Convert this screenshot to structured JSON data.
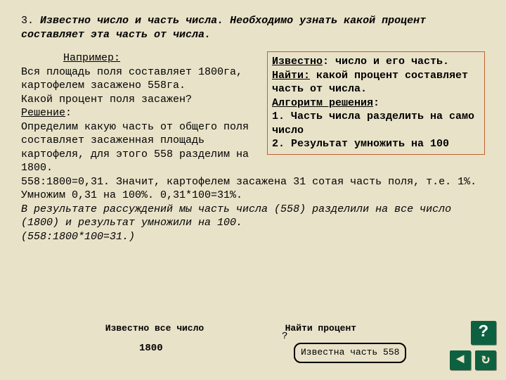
{
  "title": {
    "num": "3.",
    "text": "Известно число и часть числа. Необходимо узнать какой процент составляет эта часть от числа."
  },
  "known_box": {
    "l1a": "Известно",
    "l1b": ": число и его часть.",
    "l2a": "Найти:",
    "l2b": " какой процент составляет часть от числа.",
    "l3a": "Алгоритм решения",
    "l3b": ":",
    "s1": "1. Часть числа разделить на само число",
    "s2": "2. Результат умножить на 100"
  },
  "body": {
    "example_label": "Например:",
    "p1": "Вся площадь поля составляет 1800га, картофелем засажено 558га.",
    "p2": "Какой процент поля засажен?",
    "solution_label": "Решение",
    "p3": "Определим какую часть от общего поля составляет засаженная площадь картофеля, для этого 558 разделим на 1800.",
    "p4": "558:1800=0,31. Значит, картофелем засажена 31 сотая часть поля, т.е. 1%. Умножим 0,31 на 100%. 0,31*100=31%.",
    "p5": "В результате рассуждений мы часть числа (558) разделили на все число (1800) и результат умножили на 100.",
    "p6": "(558:1800*100=31.)"
  },
  "annot": {
    "all_number": "Известно все число",
    "find_percent": "Найти процент",
    "n1800": "1800",
    "q": "?",
    "known_part": "Известна часть 558"
  },
  "nav": {
    "help": "?",
    "back": "◄",
    "return": "↻"
  }
}
